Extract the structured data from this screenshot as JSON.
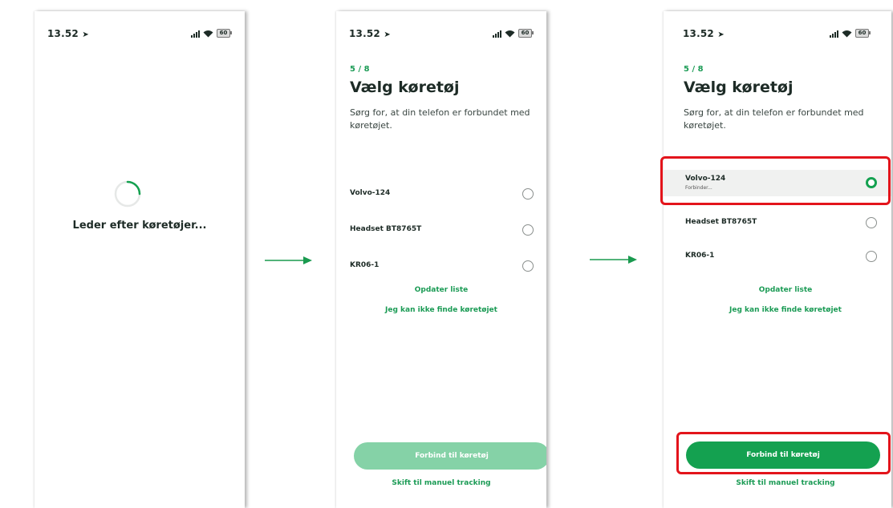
{
  "screens": [
    {
      "status": {
        "time": "13.52",
        "battery": "60"
      },
      "loading_text": "Leder efter køretøjer..."
    },
    {
      "status": {
        "time": "13.52",
        "battery": "60"
      },
      "step": "5 / 8",
      "title": "Vælg køretøj",
      "subtitle": "Sørg for, at din telefon er forbundet med køretøjet.",
      "devices": [
        "Volvo-124",
        "Headset BT8765T",
        "KR06-1"
      ],
      "refresh_link": "Opdater liste",
      "not_found_link": "Jeg kan ikke finde køretøjet",
      "connect_button": "Forbind til køretøj",
      "manual_link": "Skift til manuel tracking"
    },
    {
      "status": {
        "time": "13.52",
        "battery": "60"
      },
      "step": "5 / 8",
      "title": "Vælg køretøj",
      "subtitle": "Sørg for, at din telefon er forbundet med køretøjet.",
      "devices": [
        "Volvo-124",
        "Headset BT8765T",
        "KR06-1"
      ],
      "selected_status": "Forbinder...",
      "refresh_link": "Opdater liste",
      "not_found_link": "Jeg kan ikke finde køretøjet",
      "connect_button": "Forbind til køretøj",
      "manual_link": "Skift til manuel tracking"
    }
  ],
  "colors": {
    "brand_green": "#14a150",
    "disabled_green": "#85d2a7",
    "highlight_red": "#e3141b",
    "arrow_green": "#1a9a4f"
  },
  "icons": [
    "location-arrow-icon",
    "signal-icon",
    "wifi-icon",
    "battery-icon",
    "loading-spinner-icon",
    "radio-icon",
    "arrow-right-icon"
  ]
}
